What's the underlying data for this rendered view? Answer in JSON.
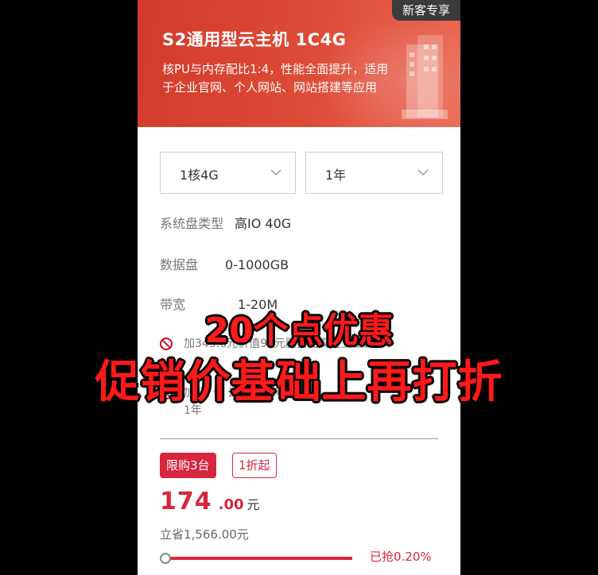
{
  "banner": {
    "badge": "新客专享",
    "title": "S2通用型云主机 1C4G",
    "desc_line1": "核PU与内存配比1:4，性能全面提升，适用",
    "desc_line2": "于企业官网、个人网站、网站搭建等应用"
  },
  "selects": [
    {
      "value": "1核4G"
    },
    {
      "value": "1年"
    }
  ],
  "specs": {
    "disk_type": {
      "label": "系统盘类型",
      "value": "高IO 40G"
    },
    "data_disk": {
      "label": "数据盘",
      "value": "0-1000GB"
    },
    "bandwidth": {
      "label": "带宽",
      "value": "1-20M"
    }
  },
  "gifts": [
    {
      "text": "加345.6元价值92元服务器安全卫士企"
    },
    {
      "text": "加 元 值 云电脑2C4G 版"
    },
    {
      "text": "1年"
    }
  ],
  "tags": {
    "limit": "限购3台",
    "discount": "1折起"
  },
  "price": {
    "integer": "174",
    "decimal": ".00",
    "unit": "元"
  },
  "save_text": "立省1,566.00元",
  "sold": {
    "text": "已抢0.20%",
    "percent": 0.2
  },
  "overlay": {
    "line1": "20个点优惠",
    "line2": "促销价基础上再打折"
  },
  "colors": {
    "brand_red": "#d7263d",
    "banner_red": "#d23a2a",
    "overlay_red": "#ff1a1a"
  },
  "icons": [
    "chevron-down-icon",
    "chevron-down-icon",
    "no-icon",
    "no-icon",
    "building-illustration"
  ]
}
